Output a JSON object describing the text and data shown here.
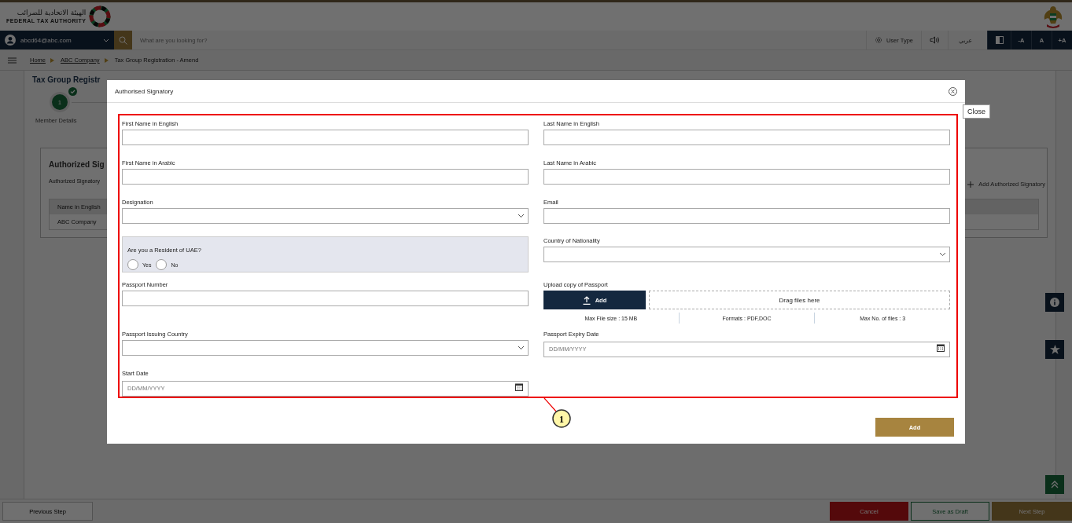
{
  "header": {
    "logo_ar": "الهيئة الاتحادية للضرائب",
    "logo_en": "FEDERAL TAX AUTHORITY"
  },
  "navbar": {
    "user": "abcd64@abc.com",
    "search_placeholder": "What are you looking for?",
    "user_type": "User Type",
    "language": "عربي",
    "font_buttons": [
      "-A",
      "A",
      "+A"
    ]
  },
  "breadcrumb": [
    {
      "label": "Home",
      "link": true
    },
    {
      "label": "ABC Company",
      "link": true
    },
    {
      "label": "Tax Group Registration - Amend",
      "link": false
    }
  ],
  "page_title": "Tax Group Registr",
  "stepper": [
    {
      "number": "1",
      "label": "Member Details",
      "completed": true
    }
  ],
  "signatory_card": {
    "title": "Authorized Sig",
    "subtitle": "Authorized Signatory",
    "add_link": "Add Authorized Signatory",
    "table": {
      "columns": [
        "Name in English"
      ],
      "rows": [
        [
          "ABC Company"
        ]
      ]
    }
  },
  "footer": {
    "previous": "Previous Step",
    "cancel": "Cancel",
    "save": "Save as Draft",
    "next": "Next Step"
  },
  "dialog": {
    "title": "Authorised Signatory",
    "close_tooltip": "Close",
    "add_button": "Add",
    "callout": "1",
    "fields": [
      {
        "kind": "text",
        "label": "First Name in English"
      },
      {
        "kind": "text",
        "label": "Last Name in English"
      },
      {
        "kind": "text",
        "label": "First Name in Arabic"
      },
      {
        "kind": "text",
        "label": "Last Name in Arabic"
      },
      {
        "kind": "select",
        "label": "Designation"
      },
      {
        "kind": "text",
        "label": "Email"
      },
      {
        "kind": "radio",
        "label": "Are you a Resident of UAE?",
        "options": [
          {
            "label": "Yes",
            "selected": false
          },
          {
            "label": "No",
            "selected": false
          }
        ]
      },
      {
        "kind": "select",
        "label": "Country of Nationality"
      },
      {
        "kind": "text",
        "label": "Passport Number"
      },
      {
        "kind": "upload",
        "label": "Upload copy of Passport",
        "button": "Add",
        "drop_text": "Drag files here",
        "notes": [
          "Max File size : 15 MB",
          "Formats : PDF,DOC",
          "Max No. of files : 3"
        ]
      },
      {
        "kind": "select",
        "label": "Passport Issuing Country"
      },
      {
        "kind": "date",
        "label": "Passport Expiry Date",
        "placeholder": "DD/MM/YYYY"
      },
      {
        "kind": "date",
        "label": "Start Date",
        "placeholder": "DD/MM/YYYY"
      }
    ]
  }
}
